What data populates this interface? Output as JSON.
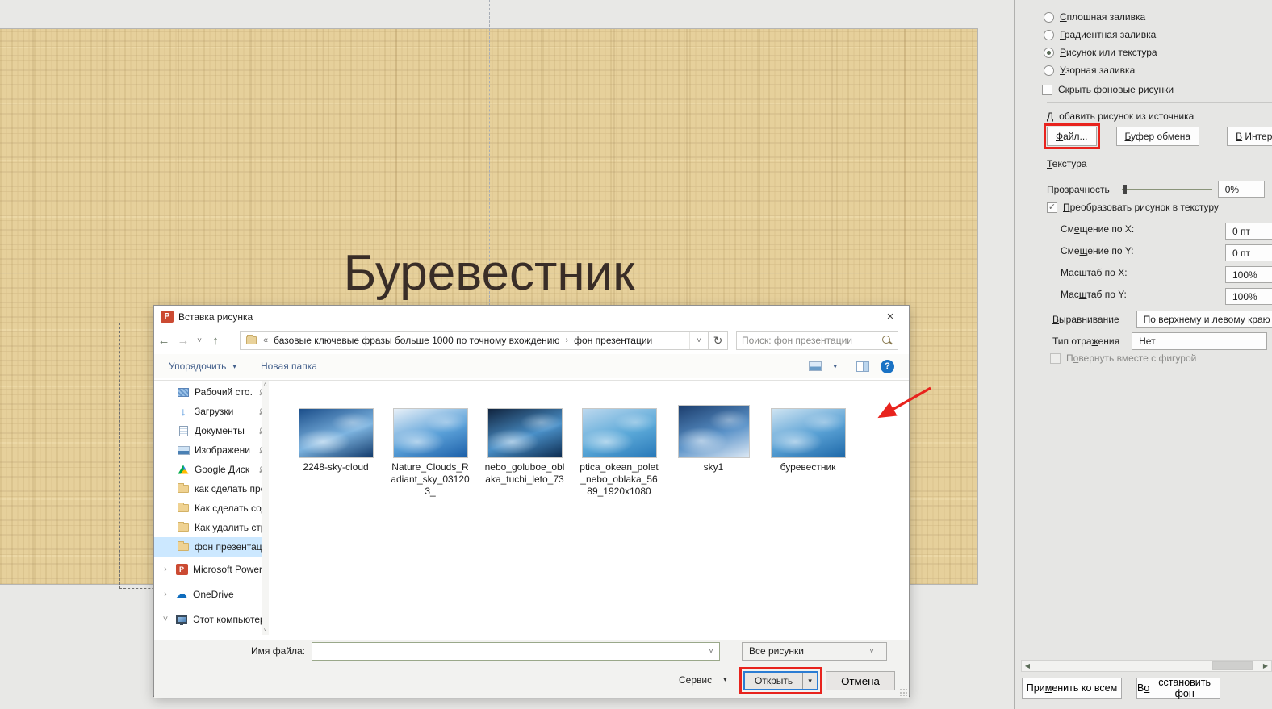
{
  "colors": {
    "accent_red": "#e8231d",
    "slide_tan": "#e6d09b",
    "selection_blue": "#cce8ff",
    "open_button_focus": "#2b7cd3"
  },
  "icons": {
    "back": "←",
    "forward": "→",
    "up": "↑",
    "dropdown": "˅",
    "refresh": "↻",
    "caret": "▾",
    "crumb_collapsed": "«",
    "crumb_sep": "›",
    "tree_collapsed": "›",
    "tree_expanded": "˅",
    "scroll_up": "˄",
    "scroll_down": "˅",
    "scroll_left": "◀",
    "scroll_right": "▶",
    "check": "✓",
    "close": "×",
    "help": "?",
    "downloads_glyph": "↓",
    "cloud_glyph": "☁",
    "ppt_glyph": "P"
  },
  "slide": {
    "title": "Буревестник"
  },
  "format_pane": {
    "fill_options": [
      {
        "label": "Сплошная заливка",
        "u": 0,
        "selected": false
      },
      {
        "label": "Градиентная заливка",
        "u": 0,
        "selected": false
      },
      {
        "label": "Рисунок или текстура",
        "u": 0,
        "selected": true
      },
      {
        "label": "Узорная заливка",
        "u": 0,
        "selected": false
      }
    ],
    "hide_bg_checkbox": {
      "label": "Скрыть фоновые рисунки",
      "u": 3,
      "checked": false
    },
    "insert_from_label": {
      "label": "Добавить рисунок из источника",
      "u": 0
    },
    "source_buttons": [
      {
        "label": "Файл...",
        "u": 0,
        "highlighted": true
      },
      {
        "label": "Буфер обмена",
        "u": 0
      },
      {
        "label": "В Интернет",
        "u": 0
      }
    ],
    "texture_label": {
      "label": "Текстура",
      "u": 0
    },
    "transparency": {
      "label": "Прозрачность",
      "u": 0,
      "value": "0%"
    },
    "tile_checkbox": {
      "label": "Преобразовать рисунок в текстуру",
      "u": 0,
      "checked": true
    },
    "fields": [
      {
        "label": "Смещение по X:",
        "u": 2,
        "value": "0 пт"
      },
      {
        "label": "Смещение по Y:",
        "u": 3,
        "value": "0 пт"
      },
      {
        "label": "Масштаб по X:",
        "u": 0,
        "value": "100%"
      },
      {
        "label": "Масштаб по Y:",
        "u": 3,
        "value": "100%"
      }
    ],
    "alignment": {
      "label": "Выравнивание",
      "u": 0,
      "value": "По верхнему и левому краю"
    },
    "mirror": {
      "label": "Тип отражения",
      "u": 8,
      "value": "Нет"
    },
    "rotate_checkbox": {
      "label": "Повернуть вместе с фигурой",
      "u": 1,
      "checked": false,
      "disabled": true
    },
    "footer_buttons": [
      {
        "label": "Применить ко всем",
        "u": 3
      },
      {
        "label": "Восстановить фон",
        "u": 1
      }
    ]
  },
  "dialog": {
    "title": "Вставка рисунка",
    "breadcrumb": {
      "collapsed": "«",
      "part1": "базовые ключевые фразы больше 1000 по точному вхождению",
      "separator": "›",
      "part2": "фон презентации"
    },
    "search": {
      "placeholder": "Поиск: фон презентации"
    },
    "toolbar": {
      "organize": "Упорядочить",
      "new_folder": "Новая папка"
    },
    "sidebar": [
      {
        "label": "Рабочий сто.",
        "icon": "desktop",
        "pinned": true
      },
      {
        "label": "Загрузки",
        "icon": "downloads",
        "pinned": true
      },
      {
        "label": "Документы",
        "icon": "documents",
        "pinned": true
      },
      {
        "label": "Изображени",
        "icon": "pictures",
        "pinned": true
      },
      {
        "label": "Google Диск",
        "icon": "gdrive",
        "pinned": true
      },
      {
        "label": "как сделать пре",
        "icon": "folder"
      },
      {
        "label": "Как сделать сод",
        "icon": "folder"
      },
      {
        "label": "Как удалить стр",
        "icon": "folder"
      },
      {
        "label": "фон презентаци",
        "icon": "folder",
        "selected": true
      },
      {
        "label": "Microsoft PowerP",
        "icon": "powerpoint",
        "state": "collapsed"
      },
      {
        "label": "OneDrive",
        "icon": "onedrive",
        "state": "collapsed"
      },
      {
        "label": "Этот компьютер",
        "icon": "computer",
        "state": "expanded"
      }
    ],
    "files": [
      {
        "label": "2248-sky-cloud",
        "colors": [
          "#1b4e8a",
          "#7db4e0",
          "#123a6b"
        ]
      },
      {
        "label": "Nature_Clouds_Radiant_sky_031203_",
        "colors": [
          "#e8f0f8",
          "#5aa0d8",
          "#1c5fa8"
        ]
      },
      {
        "label": "nebo_goluboe_oblaka_tuchi_leto_73",
        "colors": [
          "#10243f",
          "#4a90c8",
          "#0d2c50"
        ]
      },
      {
        "label": "ptica_okean_polet_nebo_oblaka_5689_1920x1080",
        "colors": [
          "#bcd8ee",
          "#5aa8d8",
          "#2878b8"
        ]
      },
      {
        "label": "sky1",
        "colors": [
          "#1c3e6e",
          "#5a92c8",
          "#dce8f4"
        ]
      },
      {
        "label": "буревестник",
        "colors": [
          "#cfe4f2",
          "#58a0d4",
          "#1e68a8"
        ]
      }
    ],
    "filename": {
      "label": "Имя файла:",
      "value": ""
    },
    "filetype": {
      "value": "Все рисунки"
    },
    "footer": {
      "tools": "Сервис",
      "open": "Открыть",
      "cancel": "Отмена"
    }
  }
}
